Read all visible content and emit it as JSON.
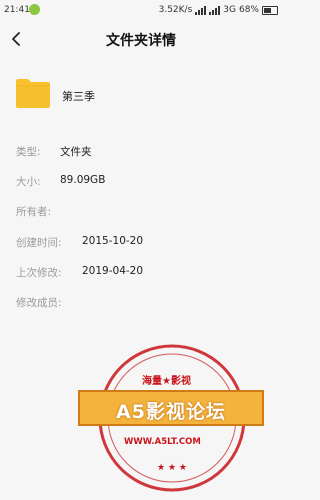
{
  "status_bar": {
    "time": "21:41",
    "speed": "3.52K/s",
    "network": "3G",
    "battery": "68%",
    "battery_level": 0.68
  },
  "header": {
    "title": "文件夹详情"
  },
  "folder": {
    "name": "第三季",
    "icon": "folder-icon",
    "color": "#f7c12e"
  },
  "details": [
    {
      "label": "类型:",
      "value": "文件夹"
    },
    {
      "label": "大小:",
      "value": "89.09GB"
    },
    {
      "label": "所有者:",
      "value": ""
    },
    {
      "label": "创建时间:",
      "value": "2015-10-20"
    },
    {
      "label": "上次修改:",
      "value": "2019-04-20"
    },
    {
      "label": "修改成员:",
      "value": ""
    }
  ],
  "watermark": {
    "top_text": "海量★影视",
    "banner_text": "A5影视论坛",
    "url": "WWW.A5LT.COM",
    "color": "#c8151b"
  }
}
